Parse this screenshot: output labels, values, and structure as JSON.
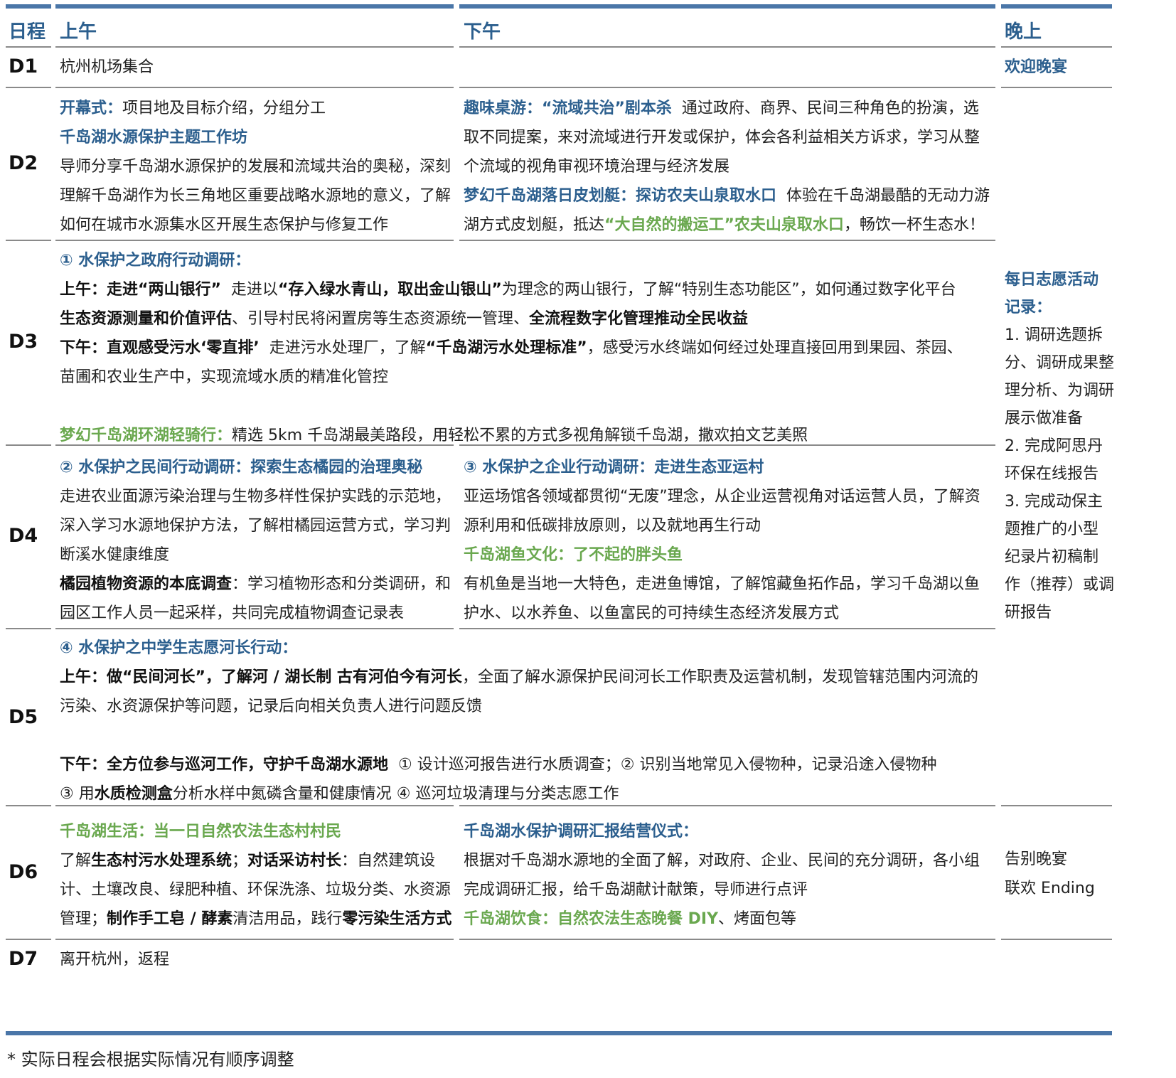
{
  "headers": {
    "day": "日程",
    "am": "上午",
    "pm": "下午",
    "eve": "晚上"
  },
  "d1": {
    "day": "D1",
    "am": "杭州机场集合",
    "eve": "欢迎晚宴"
  },
  "d2": {
    "day": "D2",
    "am1_b": "开幕式：",
    "am1_t": "项目地及目标介绍，分组分工",
    "am2_b": "千岛湖水源保护主题工作坊",
    "am3": "导师分享千岛湖水源保护的发展和流域共治的奥秘，深刻",
    "am4": "理解千岛湖作为长三角地区重要战略水源地的意义，了解",
    "am5": "如何在城市水源集水区开展生态保护与修复工作",
    "pm1_b": "趣味桌游：“流域共治”剧本杀",
    "pm1_t": "通过政府、商界、民间三种角色的扮演，选",
    "pm2": "取不同提案，来对流域进行开发或保护，体会各利益相关方诉求，学习从整",
    "pm3": "个流域的视角审视环境治理与经济发展",
    "pm4_b": "梦幻千岛湖落日皮划艇：探访农夫山泉取水口",
    "pm4_t": "体验在千岛湖最酷的无动力游",
    "pm5_a": "湖方式皮划艇，抵达",
    "pm5_g": "“大自然的搬运工”农夫山泉取水口",
    "pm5_c": "，畅饮一杯生态水！"
  },
  "d3": {
    "day": "D3",
    "l1_b": "① 水保护之政府行动调研：",
    "l2_b1": "上午：走进“两山银行”",
    "l2_t1": "走进以",
    "l2_b2": "“存入绿水青山，取出金山银山”",
    "l2_t2": "为理念的两山银行，了解“特别生态功能区”，如何通过数字化平台",
    "l3_b1": "生态资源测量和价值评估",
    "l3_t1": "、引导村民将闲置房等生态资源统一管理、",
    "l3_b2": "全流程数字化管理推动全民收益",
    "l4_b1": "下午：直观感受污水‘零直排’",
    "l4_t1": "走进污水处理厂，了解",
    "l4_b2": "“千岛湖污水处理标准”",
    "l4_t2": "，感受污水终端如何经过处理直接回用到果园、茶园、",
    "l5": "苗圃和农业生产中，实现流域水质的精准化管控",
    "l6_g": "梦幻千岛湖环湖轻骑行：",
    "l6_t": "精选 5km 千岛湖最美路段，用轻松不累的方式多视角解锁千岛湖，撒欢拍文艺美照"
  },
  "volunteer": {
    "title1": "每日志愿活动",
    "title2": "记录：",
    "items": [
      "1. 调研选题拆",
      "分、调研成果整",
      "理分析、为调研",
      "展示做准备",
      "2. 完成阿思丹",
      "环保在线报告",
      "3. 完成动保主",
      "题推广的小型",
      "纪录片初稿制",
      "作（推荐）或调",
      "研报告"
    ]
  },
  "d4": {
    "day": "D4",
    "am1_b": "② 水保护之民间行动调研：探索生态橘园的治理奥秘",
    "am2": "走进农业面源污染治理与生物多样性保护实践的示范地，",
    "am3": "深入学习水源地保护方法，了解柑橘园运营方式，学习判",
    "am4": "断溪水健康维度",
    "am5_b": "橘园植物资源的本底调查",
    "am5_t": "：学习植物形态和分类调研，和",
    "am6": "园区工作人员一起采样，共同完成植物调查记录表",
    "pm1_b": "③ 水保护之企业行动调研：走进生态亚运村",
    "pm2": "亚运场馆各领域都贯彻“无废”理念，从企业运营视角对话运营人员，了解资",
    "pm3": "源利用和低碳排放原则，以及就地再生行动",
    "pm4_g": "千岛湖鱼文化：了不起的胖头鱼",
    "pm5": "有机鱼是当地一大特色，走进鱼博馆，了解馆藏鱼拓作品，学习千岛湖以鱼",
    "pm6": "护水、以水养鱼、以鱼富民的可持续生态经济发展方式"
  },
  "d5": {
    "day": "D5",
    "l1_b": "④ 水保护之中学生志愿河长行动：",
    "l2_b": "上午：做“民间河长”，了解河 / 湖长制  古有河伯今有河长",
    "l2_t": "，全面了解水源保护民间河长工作职责及运营机制，发现管辖范围内河流的",
    "l3": "污染、水资源保护等问题，记录后向相关负责人进行问题反馈",
    "l4_b": "下午：全方位参与巡河工作，守护千岛湖水源地",
    "l4_t": "① 设计巡河报告进行水质调查；② 识别当地常见入侵物种，记录沿途入侵物种",
    "l5_a": "③ 用",
    "l5_b": "水质检测盒",
    "l5_c": "分析水样中氮磷含量和健康情况  ④ 巡河垃圾清理与分类志愿工作"
  },
  "d6": {
    "day": "D6",
    "am1_g": "千岛湖生活：当一日自然农法生态村村民",
    "am2_a": "了解",
    "am2_b1": "生态村污水处理系统",
    "am2_c": "；",
    "am2_b2": "对话采访村长",
    "am2_d": "：自然建筑设",
    "am3": "计、土壤改良、绿肥种植、环保洗涤、垃圾分类、水资源",
    "am4_a": "管理；",
    "am4_b1": "制作手工皂 / 酵素",
    "am4_c": "清洁用品，践行",
    "am4_b2": "零污染生活方式",
    "pm1_b": "千岛湖水保护调研汇报结营仪式：",
    "pm2": "根据对千岛湖水源地的全面了解，对政府、企业、民间的充分调研，各小组",
    "pm3": "完成调研汇报，给千岛湖献计献策，导师进行点评",
    "pm4_g": "千岛湖饮食：自然农法生态晚餐 DIY",
    "pm4_t": "、烤面包等",
    "eve1": "告别晚宴",
    "eve2": "联欢 Ending"
  },
  "d7": {
    "day": "D7",
    "am": "离开杭州，返程"
  },
  "footnote": "* 实际日程会根据实际情况有顺序调整"
}
